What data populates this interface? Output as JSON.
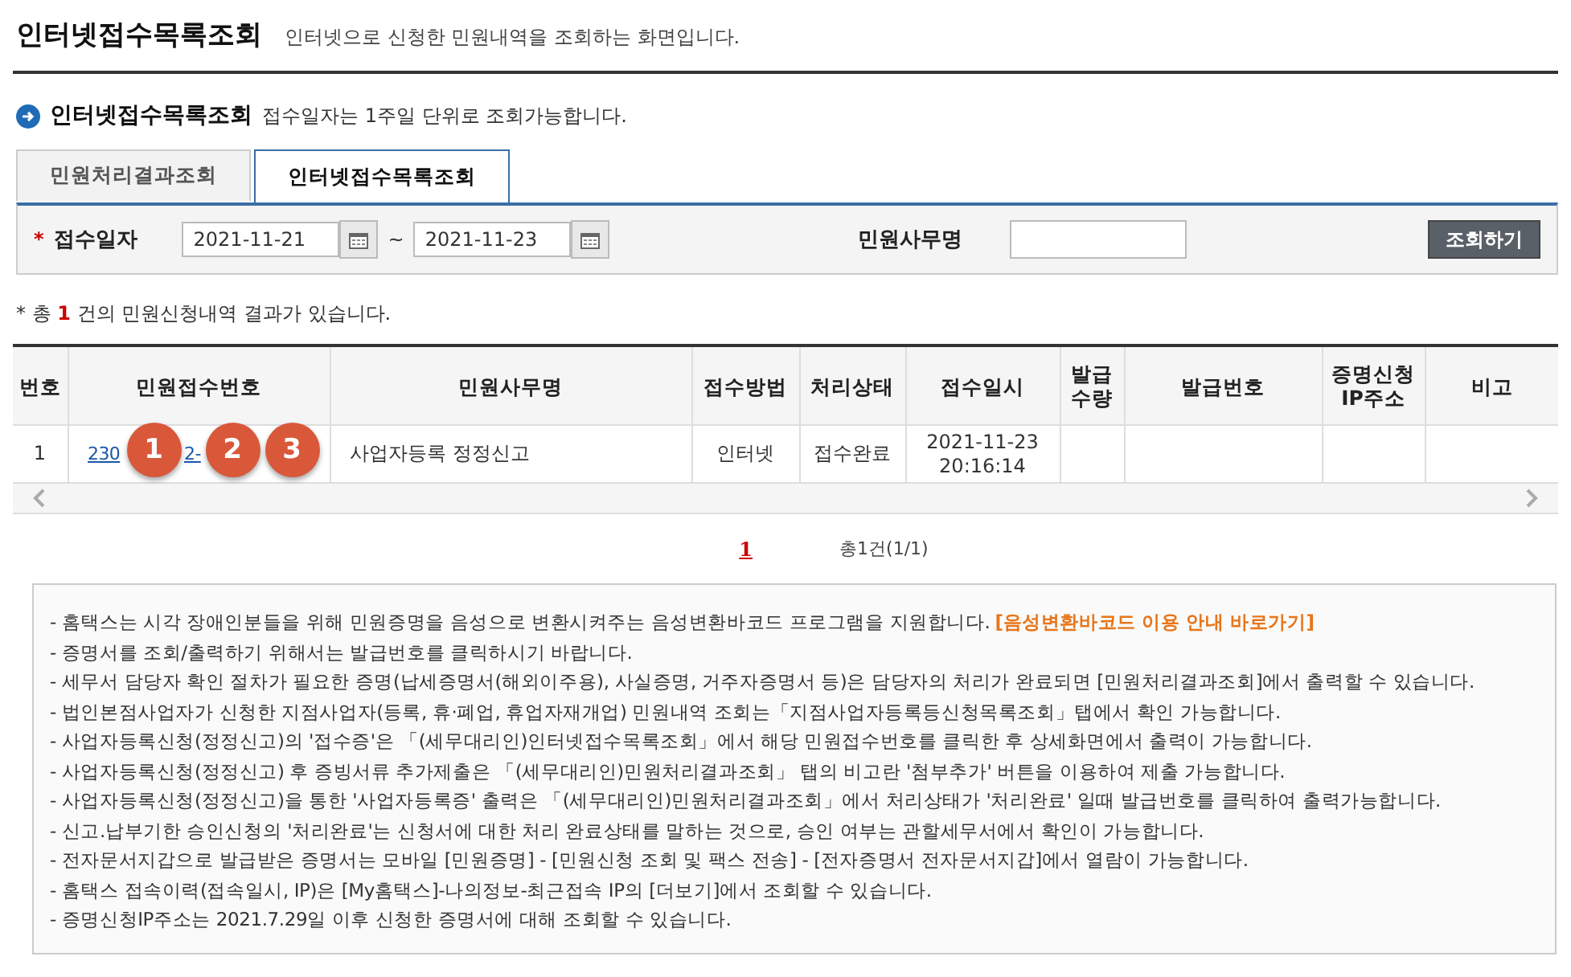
{
  "page_header": {
    "title": "인터넷접수목록조회",
    "description": "인터넷으로 신청한 민원내역을 조회하는 화면입니다."
  },
  "section": {
    "title": "인터넷접수목록조회",
    "note": "접수일자는 1주일 단위로 조회가능합니다."
  },
  "tabs": [
    {
      "label": "민원처리결과조회",
      "selected": false
    },
    {
      "label": "인터넷접수목록조회",
      "selected": true
    }
  ],
  "search": {
    "required_mark": "*",
    "date_label": "접수일자",
    "date_from": "2021-11-21",
    "separator": "~",
    "date_to": "2021-11-23",
    "office_label": "민원사무명",
    "button": "조회하기"
  },
  "result_summary": "* 총 **1** 건의 민원신청내역 결과가 있습니다.",
  "table": {
    "columns": [
      "번호",
      "민원접수번호",
      "민원사무명",
      "접수방법",
      "처리상태",
      "접수일시",
      "발급\n수량",
      "발급번호",
      "증명신청\nIP주소",
      "비고"
    ],
    "rows": [
      {
        "number": "1",
        "receipt_number": [
          "230",
          "2-"
        ],
        "office": "사업자등록 정정신고",
        "method": "인터넷",
        "status": "접수완료",
        "received_at": "2021-11-23\n20:16:14"
      }
    ]
  },
  "annotations": [
    {
      "label": "1"
    },
    {
      "label": "2"
    },
    {
      "label": "3"
    }
  ],
  "pagination": {
    "pages": [
      {
        "label": "1",
        "selected": true
      }
    ],
    "total": "총1건(1/1)"
  },
  "notices": [
    {
      "text": "- 홈택스는 시각 장애인분들을 위해 민원증명을 음성으로 변환시켜주는 음성변환바코드 프로그램을 지원합니다.",
      "link": "[음성변환바코드 이용 안내 바로가기]"
    },
    {
      "text": "- 증명서를 조회/출력하기 위해서는 발급번호를 클릭하시기 바랍니다."
    },
    {
      "text": "- 세무서 담당자 확인 절차가 필요한 증명(납세증명서(해외이주용), 사실증명, 거주자증명서 등)은 담당자의 처리가 완료되면 [민원처리결과조회]에서 출력할 수 있습니다."
    },
    {
      "text": "- 법인본점사업자가 신청한 지점사업자(등록, 휴·폐업, 휴업자재개업) 민원내역 조회는「지점사업자등록등신청목록조회」탭에서 확인 가능합니다."
    },
    {
      "text": "- 사업자등록신청(정정신고)의 '접수증'은 「(세무대리인)인터넷접수목록조회」에서 해당 민원접수번호를 클릭한 후 상세화면에서 출력이 가능합니다."
    },
    {
      "text": "- 사업자등록신청(정정신고) 후 증빙서류 추가제출은 「(세무대리인)민원처리결과조회」 탭의 비고란 '첨부추가' 버튼을 이용하여 제출 가능합니다."
    },
    {
      "text": "- 사업자등록신청(정정신고)을 통한 '사업자등록증' 출력은 「(세무대리인)민원처리결과조회」에서 처리상태가 '처리완료' 일때 발급번호를 클릭하여 출력가능합니다."
    },
    {
      "text": "- 신고.납부기한 승인신청의 '처리완료'는 신청서에 대한 처리 완료상태를 말하는 것으로, 승인 여부는 관할세무서에서 확인이 가능합니다."
    },
    {
      "text": "- 전자문서지갑으로 발급받은 증명서는 모바일 [민원증명] - [민원신청 조회 및 팩스 전송] - [전자증명서 전자문서지갑]에서 열람이 가능합니다."
    },
    {
      "text": "- 홈택스 접속이력(접속일시, IP)은 [My홈택스]-나의정보-최근접속 IP의 [더보기]에서 조회할 수 있습니다."
    },
    {
      "text": "- 증명신청IP주소는 2021.7.29일 이후 신청한 증명서에 대해 조회할 수 있습니다."
    }
  ]
}
